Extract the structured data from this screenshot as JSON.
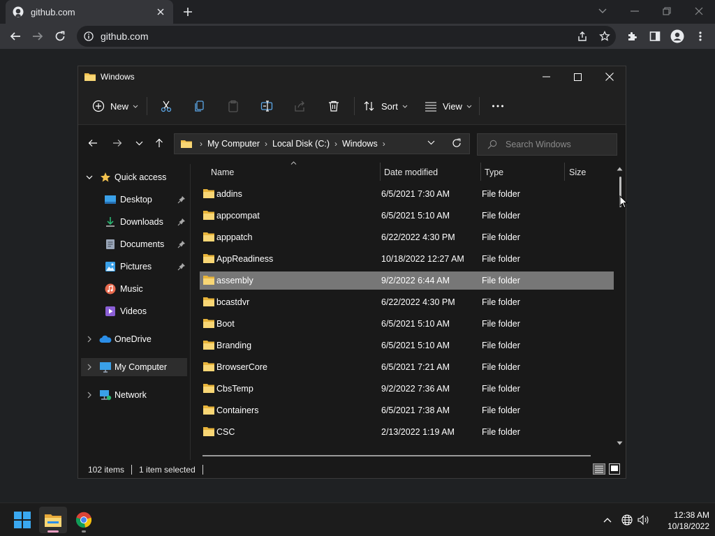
{
  "browser": {
    "tab_title": "github.com",
    "url": "github.com"
  },
  "explorer": {
    "window_title": "Windows",
    "commands": {
      "new_label": "New",
      "sort_label": "Sort",
      "view_label": "View"
    },
    "breadcrumb": [
      "My Computer",
      "Local Disk (C:)",
      "Windows"
    ],
    "search_placeholder": "Search Windows",
    "nav": {
      "quick_access": "Quick access",
      "desktop": "Desktop",
      "downloads": "Downloads",
      "documents": "Documents",
      "pictures": "Pictures",
      "music": "Music",
      "videos": "Videos",
      "onedrive": "OneDrive",
      "my_computer": "My Computer",
      "network": "Network"
    },
    "columns": {
      "name": "Name",
      "date": "Date modified",
      "type": "Type",
      "size": "Size"
    },
    "files": [
      {
        "name": "addins",
        "date": "6/5/2021 7:30 AM",
        "type": "File folder"
      },
      {
        "name": "appcompat",
        "date": "6/5/2021 5:10 AM",
        "type": "File folder"
      },
      {
        "name": "apppatch",
        "date": "6/22/2022 4:30 PM",
        "type": "File folder"
      },
      {
        "name": "AppReadiness",
        "date": "10/18/2022 12:27 AM",
        "type": "File folder"
      },
      {
        "name": "assembly",
        "date": "9/2/2022 6:44 AM",
        "type": "File folder"
      },
      {
        "name": "bcastdvr",
        "date": "6/22/2022 4:30 PM",
        "type": "File folder"
      },
      {
        "name": "Boot",
        "date": "6/5/2021 5:10 AM",
        "type": "File folder"
      },
      {
        "name": "Branding",
        "date": "6/5/2021 5:10 AM",
        "type": "File folder"
      },
      {
        "name": "BrowserCore",
        "date": "6/5/2021 7:21 AM",
        "type": "File folder"
      },
      {
        "name": "CbsTemp",
        "date": "9/2/2022 7:36 AM",
        "type": "File folder"
      },
      {
        "name": "Containers",
        "date": "6/5/2021 7:38 AM",
        "type": "File folder"
      },
      {
        "name": "CSC",
        "date": "2/13/2022 1:19 AM",
        "type": "File folder"
      }
    ],
    "status": {
      "items": "102 items",
      "selected": "1 item selected"
    }
  },
  "taskbar": {
    "time": "12:38 AM",
    "date": "10/18/2022"
  },
  "colors": {
    "folder": "#f3c24f",
    "selection": "#777777",
    "accent": "#0078d4"
  }
}
